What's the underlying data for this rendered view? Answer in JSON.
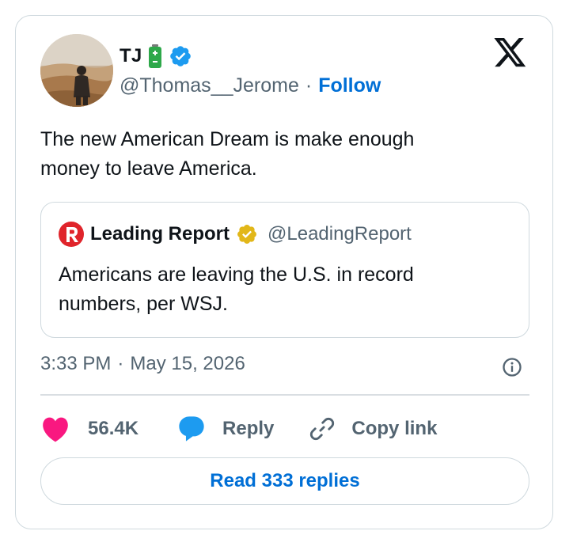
{
  "author": {
    "name": "TJ",
    "handle": "@Thomas__Jerome",
    "follow_label": "Follow",
    "separator": "·"
  },
  "tweet": {
    "line1": "The new American Dream is make enough",
    "line2": "money to leave America."
  },
  "quote": {
    "name": "Leading Report",
    "handle": "@LeadingReport",
    "line1": "Americans are leaving the U.S. in record",
    "line2": "numbers, per WSJ."
  },
  "meta": {
    "time": "3:33 PM",
    "separator": "·",
    "date": "May 15, 2026"
  },
  "actions": {
    "likes": "56.4K",
    "reply_label": "Reply",
    "copy_label": "Copy link"
  },
  "read_replies_label": "Read 333 replies",
  "icons": {
    "logo": "x-logo-icon",
    "battery": "battery-icon",
    "verified": "verified-badge-icon",
    "gold_verified": "gold-verified-badge-icon",
    "info": "info-icon",
    "like": "heart-icon",
    "reply": "speech-bubble-icon",
    "copy": "link-icon"
  },
  "colors": {
    "accent": "#006fd6",
    "verified_blue": "#1d9bf0",
    "gold": "#e2b719",
    "heart": "#f91880",
    "muted": "#536471",
    "border": "#cfd9de",
    "battery": "#2ea84a"
  }
}
